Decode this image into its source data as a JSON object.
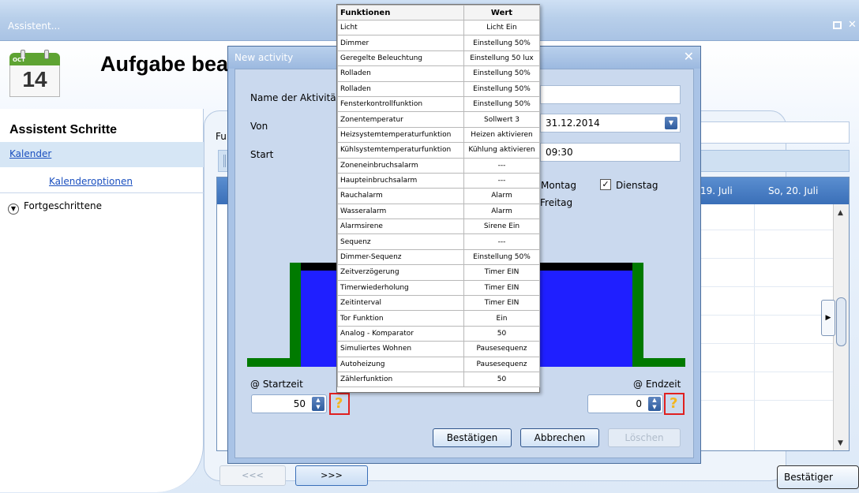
{
  "window": {
    "title": "Assistent..."
  },
  "page_title": "Aufgabe bea",
  "calendar_icon": {
    "month": "OCT",
    "day": "14"
  },
  "wizard": {
    "title": "Assistent Schritte",
    "steps": [
      "Kalender",
      "Kalenderoptionen",
      "Fortgeschrittene"
    ]
  },
  "background": {
    "fu_label": "Fu",
    "days": [
      "19. Juli",
      "So, 20. Juli"
    ],
    "prev_label": "<<<",
    "next_label": ">>>",
    "confirm_label": "Bestätiger"
  },
  "dialog": {
    "title": "New activity",
    "name_label": "Name der Aktivitä",
    "from_label": "Von",
    "from_value": "31.12.2014",
    "start_label": "Start",
    "start_value": "09:30",
    "weekday_montag": "Montag",
    "weekday_dienstag": "Dienstag",
    "weekday_freitag": "Freitag",
    "start_time_label": "@ Startzeit",
    "start_time_value": "50",
    "end_time_label": "@ Endzeit",
    "end_time_value": "0",
    "help_glyph": "?",
    "confirm": "Bestätigen",
    "cancel": "Abbrechen",
    "delete": "Löschen"
  },
  "function_table": {
    "headers": [
      "Funktionen",
      "Wert"
    ],
    "rows": [
      [
        "Licht",
        "Licht Ein"
      ],
      [
        "Dimmer",
        "Einstellung 50%"
      ],
      [
        "Geregelte Beleuchtung",
        "Einstellung 50 lux"
      ],
      [
        "Rolladen",
        "Einstellung 50%"
      ],
      [
        "Rolladen",
        "Einstellung 50%"
      ],
      [
        "Fensterkontrollfunktion",
        "Einstellung 50%"
      ],
      [
        "Zonentemperatur",
        "Sollwert 3"
      ],
      [
        "Heizsystemtemperaturfunktion",
        "Heizen aktivieren"
      ],
      [
        "Kühlsystemtemperaturfunktion",
        "Kühlung aktivieren"
      ],
      [
        "Zoneneinbruchsalarm",
        "---"
      ],
      [
        "Haupteinbruchsalarm",
        "---"
      ],
      [
        "Rauchalarm",
        "Alarm"
      ],
      [
        "Wasseralarm",
        "Alarm"
      ],
      [
        "Alarmsirene",
        "Sirene Ein"
      ],
      [
        "Sequenz",
        "---"
      ],
      [
        "Dimmer-Sequenz",
        "Einstellung 50%"
      ],
      [
        "Zeitverzögerung",
        "Timer EIN"
      ],
      [
        "Timerwiederholung",
        "Timer EIN"
      ],
      [
        "Zeitinterval",
        "Timer EIN"
      ],
      [
        "Tor Funktion",
        "Ein"
      ],
      [
        "Analog - Komparator",
        "50"
      ],
      [
        "Simuliertes Wohnen",
        "Pausesequenz"
      ],
      [
        "Autoheizung",
        "Pausesequenz"
      ],
      [
        "Zählerfunktion",
        "50"
      ]
    ]
  },
  "colors": {
    "dialog_bg": "#a9c3e6",
    "diagram_fill": "#1f1fff",
    "diagram_edge": "#007a00",
    "help_highlight": "#e02020"
  }
}
